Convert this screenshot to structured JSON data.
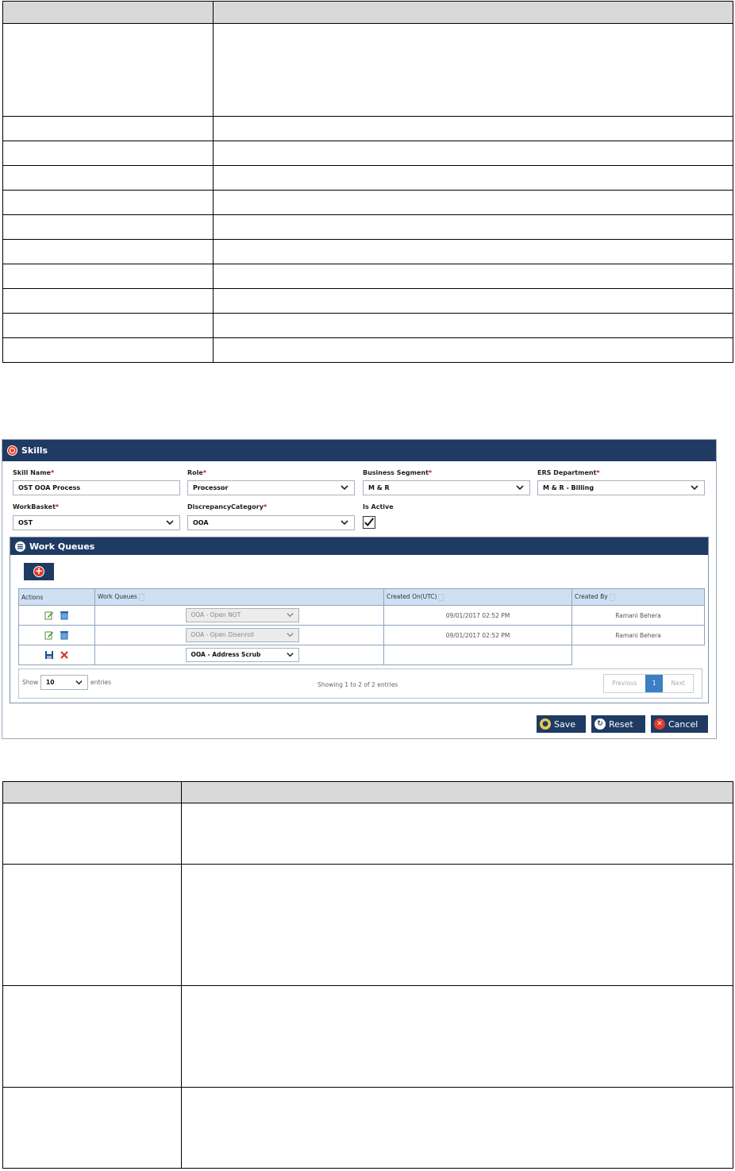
{
  "skills_panel": {
    "title": "Skills",
    "fields": {
      "skill_name": {
        "label": "Skill Name",
        "value": "OST OOA Process"
      },
      "role": {
        "label": "Role",
        "value": "Processor"
      },
      "business_segment": {
        "label": "Business Segment",
        "value": "M & R"
      },
      "ers_department": {
        "label": "ERS Department",
        "value": "M & R - Billing"
      },
      "workbasket": {
        "label": "WorkBasket",
        "value": "OST"
      },
      "discrepancy_category": {
        "label": "DiscrepancyCategory",
        "value": "OOA"
      },
      "is_active": {
        "label": "Is Active",
        "checked": true
      }
    },
    "required_mark": "*",
    "work_queues": {
      "title": "Work Queues",
      "columns": [
        "Actions",
        "Work Queues",
        "Created On(UTC)",
        "Created By"
      ],
      "rows": [
        {
          "queue": "OOA - Open NOT",
          "created_on": "09/01/2017 02:52 PM",
          "created_by": "Ramani Behera"
        },
        {
          "queue": "OOA - Open Disenroll",
          "created_on": "09/01/2017 02:52 PM",
          "created_by": "Ramani Behera"
        },
        {
          "queue": "OOA - Address Scrub"
        }
      ],
      "show_label": "Show",
      "page_length": "10",
      "entries_label": "entries",
      "info": "Showing 1 to 2 of 2 entries",
      "pager": {
        "previous": "Previous",
        "current": "1",
        "next": "Next"
      }
    },
    "buttons": {
      "save": "Save",
      "reset": "Reset",
      "cancel": "Cancel"
    }
  },
  "colors": {
    "header": "#1f3b63",
    "accent": "#e8442f",
    "grid_header": "#cfe0f3"
  }
}
